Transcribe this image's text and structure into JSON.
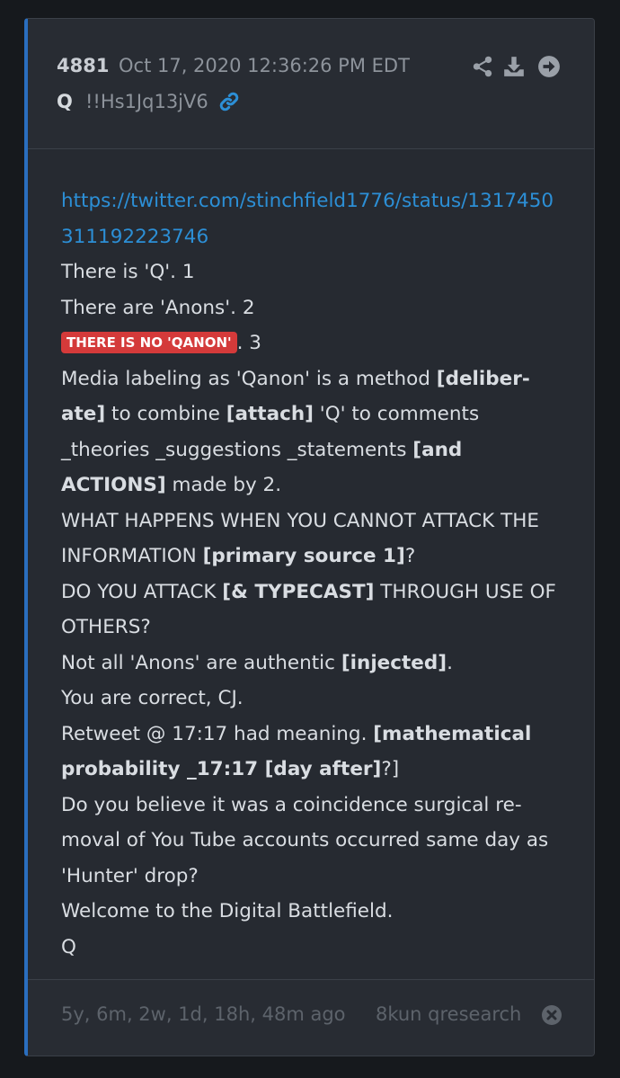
{
  "post": {
    "number": "4881",
    "date": "Oct 17, 2020 12:36:26 PM EDT",
    "author": "Q",
    "tripcode": "!!Hs1Jq13jV6"
  },
  "body": {
    "url_line1": "https://twitter.com/stinchfield1776/status/1317450",
    "url_line2": "311192223746",
    "l3": "There is 'Q'. 1",
    "l4": "There are 'Anons'. 2",
    "l5_tag": "THERE IS NO 'QANON'",
    "l5_rest": ". 3",
    "l6a": "Media labeling as 'Qanon' is a method ",
    "l6b": "[deliber-",
    "l7a": "ate]",
    "l7b": " to combine ",
    "l7c": "[attach]",
    "l7d": " 'Q' to comments",
    "l8a": "_theories _suggestions _statements ",
    "l8b": "[and",
    "l9a": "ACTIONS]",
    "l9b": " made by 2.",
    "l10": "WHAT HAPPENS WHEN YOU CANNOT ATTACK THE",
    "l11a": "INFORMATION ",
    "l11b": "[primary source 1]",
    "l11c": "?",
    "l12a": "DO YOU ATTACK ",
    "l12b": "[& TYPECAST]",
    "l12c": " THROUGH USE OF",
    "l13": "OTHERS?",
    "l14a": "Not all 'Anons' are authentic ",
    "l14b": "[injected]",
    "l14c": ".",
    "l15": "You are correct, CJ.",
    "l16a": "Retweet @ 17:17 had meaning. ",
    "l16b": "[mathematical",
    "l17a": "probability _17:17 [day after]",
    "l17b": "?]",
    "l18": "Do you believe it was a coincidence surgical re-",
    "l19": "moval of You Tube accounts occurred same day as",
    "l20": "'Hunter' drop?",
    "l21": "Welcome to the Digital Battlefield.",
    "l22": "Q"
  },
  "footer": {
    "ago": "5y, 6m, 2w, 1d, 18h, 48m ago",
    "source": "8kun qresearch"
  },
  "icons": {
    "link": "link-icon",
    "share": "share-icon",
    "download": "download-icon",
    "goto": "arrow-circle-right-icon",
    "close": "close-circle-icon"
  },
  "colors": {
    "background": "#16191d",
    "card": "#262a31",
    "accent_border": "#2a6ebf",
    "link": "#2c8fd6",
    "tag": "#d43a3a",
    "text": "#d9dde2",
    "muted": "#8d939b"
  }
}
